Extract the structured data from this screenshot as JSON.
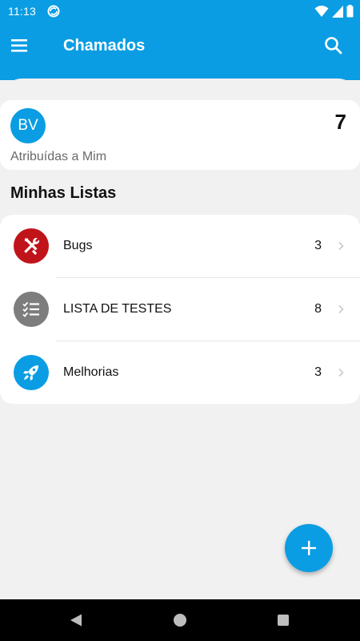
{
  "status_bar": {
    "time": "11:13"
  },
  "app_bar": {
    "title": "Chamados"
  },
  "assigned": {
    "avatar_initials": "BV",
    "count": "7",
    "label": "Atribuídas a Mim"
  },
  "section": {
    "title": "Minhas Listas"
  },
  "lists": [
    {
      "label": "Bugs",
      "count": "3",
      "icon": "tools-icon",
      "color": "#c0141a"
    },
    {
      "label": "LISTA DE TESTES",
      "count": "8",
      "icon": "checklist-icon",
      "color": "#7d7d7d"
    },
    {
      "label": "Melhorias",
      "count": "3",
      "icon": "rocket-icon",
      "color": "#0a9de3"
    }
  ],
  "colors": {
    "accent": "#0a9de3",
    "background": "#f1f1f1"
  },
  "fab": {
    "icon": "plus-icon"
  }
}
